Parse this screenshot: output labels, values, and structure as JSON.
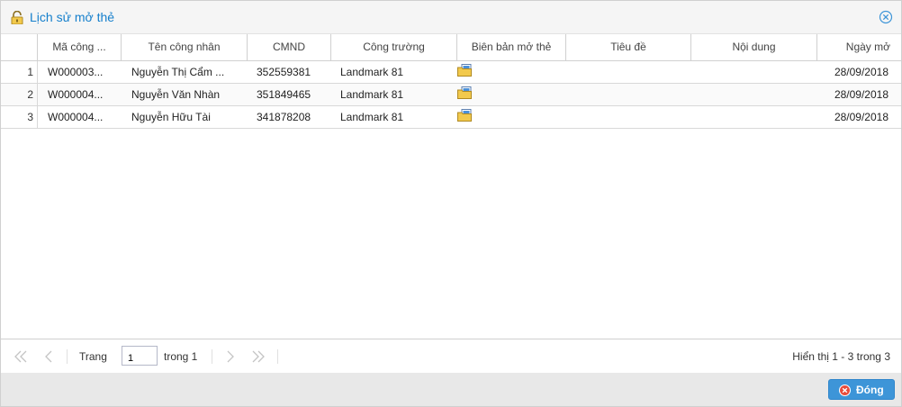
{
  "window": {
    "title": "Lịch sử mở thẻ"
  },
  "columns": [
    "",
    "Mã công ...",
    "Tên công nhân",
    "CMND",
    "Công trường",
    "Biên bản mở thẻ",
    "Tiêu đề",
    "Nội dung",
    "Ngày mở"
  ],
  "rows": [
    {
      "num": "1",
      "code": "W000003...",
      "name": "Nguyễn Thị Cẩm ...",
      "cmnd": "352559381",
      "site": "Landmark 81",
      "title": "",
      "content": "",
      "date": "28/09/2018"
    },
    {
      "num": "2",
      "code": "W000004...",
      "name": "Nguyễn Văn Nhàn",
      "cmnd": "351849465",
      "site": "Landmark 81",
      "title": "",
      "content": "",
      "date": "28/09/2018"
    },
    {
      "num": "3",
      "code": "W000004...",
      "name": "Nguyễn Hữu Tài",
      "cmnd": "341878208",
      "site": "Landmark 81",
      "title": "",
      "content": "",
      "date": "28/09/2018"
    }
  ],
  "pager": {
    "page_label": "Trang",
    "page_value": "1",
    "of_label": "trong 1",
    "info": "Hiển thị 1 - 3 trong 3"
  },
  "footer": {
    "close_label": "Đóng"
  },
  "colors": {
    "title": "#157fcc",
    "button": "#3d95d8",
    "folder": "#f2c94c"
  }
}
